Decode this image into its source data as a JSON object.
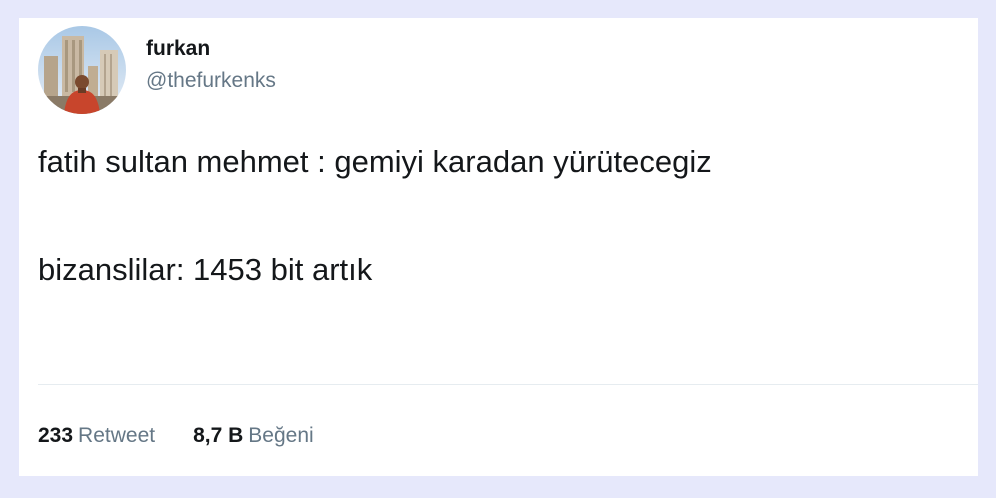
{
  "user": {
    "display_name": "furkan",
    "handle": "@thefurkenks"
  },
  "tweet": {
    "line1": "fatih sultan mehmet : gemiyi karadan yürütecegiz",
    "line2": "bizanslilar: 1453 bit artık"
  },
  "stats": {
    "retweets": {
      "count": "233",
      "label": "Retweet"
    },
    "likes": {
      "count": "8,7 B",
      "label": "Beğeni"
    }
  },
  "colors": {
    "background": "#e6e8fb",
    "card": "#ffffff",
    "text": "#14171a",
    "muted": "#657786",
    "divider": "#e6ecf0"
  }
}
